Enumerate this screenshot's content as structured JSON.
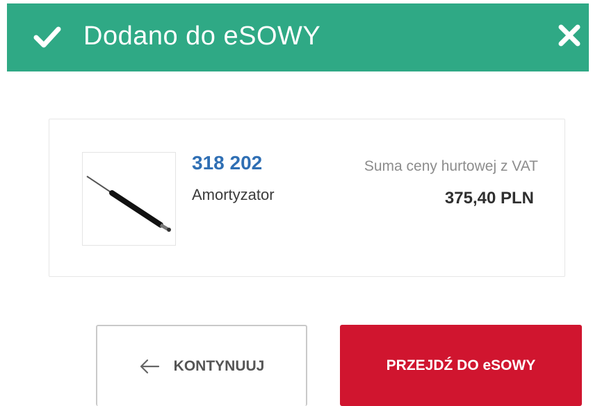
{
  "header": {
    "title": "Dodano do eSOWY",
    "check_icon": "checkmark-icon",
    "close_icon": "close-icon",
    "background_color": "#2fa985"
  },
  "product": {
    "code": "318 202",
    "name": "Amortyzator",
    "image_icon": "shock-absorber-image",
    "sum_label": "Suma ceny hurtowej z VAT",
    "sum_value": "375,40 PLN"
  },
  "actions": {
    "continue_label": "KONTYNUUJ",
    "continue_icon": "arrow-left-icon",
    "go_label": "PRZEJDŹ DO eSOWY",
    "go_color": "#d0152f"
  }
}
